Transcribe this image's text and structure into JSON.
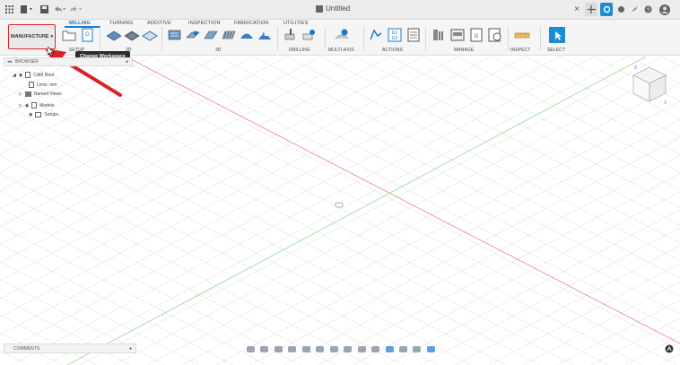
{
  "titlebar": {
    "title": "Untitled"
  },
  "ribbon": {
    "tabs": [
      "MILLING",
      "TURNING",
      "ADDITIVE",
      "INSPECTION",
      "FABRICATION",
      "UTILITIES"
    ],
    "workspace_label": "MANUFACTURE",
    "groups": [
      "SETUP",
      "2D",
      "3D",
      "DRILLING",
      "MULTI-AXIS",
      "ACTIONS",
      "MANAGE",
      "INSPECT",
      "SELECT"
    ],
    "tooltip": "Change Workspace",
    "actions_icon_text": "G1\nG2"
  },
  "browser": {
    "title": "BROWSER",
    "items": [
      "CAM Root",
      "Units: mm",
      "Named Views",
      "Models",
      "Setups"
    ]
  },
  "comments": {
    "label": "COMMENTS"
  },
  "colors": {
    "accent": "#1b7ac8",
    "highlight": "#dd2222",
    "axis_red": "#e06060",
    "axis_green": "#6fcf6f"
  }
}
